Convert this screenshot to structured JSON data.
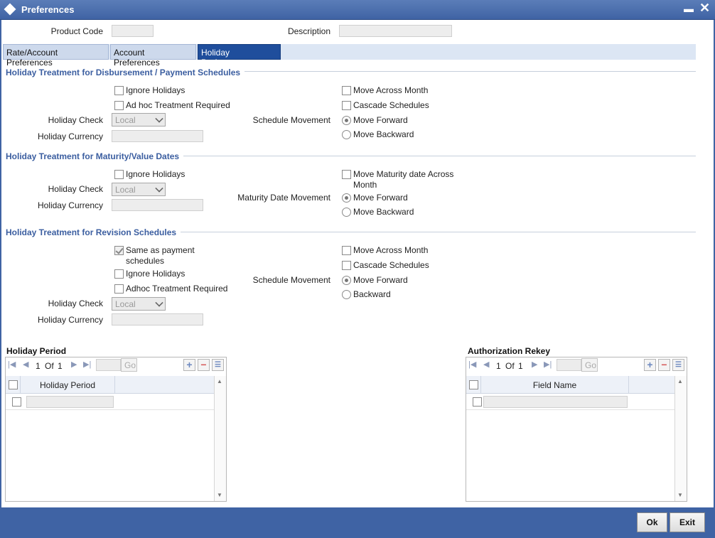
{
  "window": {
    "title": "Preferences"
  },
  "header": {
    "product_code_label": "Product Code",
    "product_code_value": "",
    "description_label": "Description",
    "description_value": ""
  },
  "tabs": [
    {
      "label": "Rate/Account Preferences",
      "active": false
    },
    {
      "label": "Account Preferences",
      "active": false
    },
    {
      "label": "Holiday Preferences",
      "active": true
    }
  ],
  "disbursement": {
    "title": "Holiday Treatment for Disbursement / Payment Schedules",
    "ignore_holidays": {
      "label": "Ignore Holidays",
      "checked": false
    },
    "adhoc": {
      "label": "Ad hoc Treatment Required",
      "checked": false
    },
    "holiday_check_label": "Holiday Check",
    "holiday_check_value": "Local",
    "holiday_currency_label": "Holiday Currency",
    "holiday_currency_value": "",
    "move_across_month": {
      "label": "Move Across Month",
      "checked": false
    },
    "cascade_schedules": {
      "label": "Cascade Schedules",
      "checked": false
    },
    "schedule_movement_label": "Schedule Movement",
    "move_forward": {
      "label": "Move Forward",
      "selected": true
    },
    "move_backward": {
      "label": "Move Backward",
      "selected": false
    }
  },
  "maturity": {
    "title": "Holiday Treatment for Maturity/Value Dates",
    "ignore_holidays": {
      "label": "Ignore Holidays",
      "checked": false
    },
    "holiday_check_label": "Holiday Check",
    "holiday_check_value": "Local",
    "holiday_currency_label": "Holiday Currency",
    "holiday_currency_value": "",
    "move_maturity_line1": "Move Maturity date Across",
    "move_maturity_line2": "Month",
    "move_maturity_checked": false,
    "maturity_movement_label": "Maturity Date Movement",
    "move_forward": {
      "label": "Move Forward",
      "selected": true
    },
    "move_backward": {
      "label": "Move Backward",
      "selected": false
    }
  },
  "revision": {
    "title": "Holiday Treatment for Revision Schedules",
    "same_as_payment_line1": "Same as payment",
    "same_as_payment_line2": "schedules",
    "same_as_payment_checked": true,
    "ignore_holidays": {
      "label": "Ignore Holidays",
      "checked": false
    },
    "adhoc": {
      "label": "Adhoc Treatment Required",
      "checked": false
    },
    "holiday_check_label": "Holiday Check",
    "holiday_check_value": "Local",
    "holiday_currency_label": "Holiday Currency",
    "holiday_currency_value": "",
    "move_across_month": {
      "label": "Move Across Month",
      "checked": false
    },
    "cascade_schedules": {
      "label": "Cascade Schedules",
      "checked": false
    },
    "schedule_movement_label": "Schedule Movement",
    "move_forward": {
      "label": "Move Forward",
      "selected": true
    },
    "backward": {
      "label": "Backward",
      "selected": false
    }
  },
  "holiday_period_grid": {
    "title": "Holiday Period",
    "page": "1",
    "of_label": "Of",
    "total": "1",
    "go_label": "Go",
    "column": "Holiday Period"
  },
  "auth_rekey_grid": {
    "title": "Authorization Rekey",
    "page": "1",
    "of_label": "Of",
    "total": "1",
    "go_label": "Go",
    "column": "Field Name"
  },
  "footer": {
    "ok_label": "Ok",
    "exit_label": "Exit"
  },
  "colors": {
    "title_bar": "#3f63a4",
    "active_tab": "#1f4e9c",
    "section_title": "#3b5ea0"
  },
  "icons": [
    "preferences-diamond-icon",
    "minimize-icon",
    "close-icon",
    "first-page-icon",
    "prev-page-icon",
    "next-page-icon",
    "last-page-icon",
    "add-row-icon",
    "delete-row-icon",
    "single-view-icon",
    "scroll-up-icon",
    "scroll-down-icon"
  ]
}
